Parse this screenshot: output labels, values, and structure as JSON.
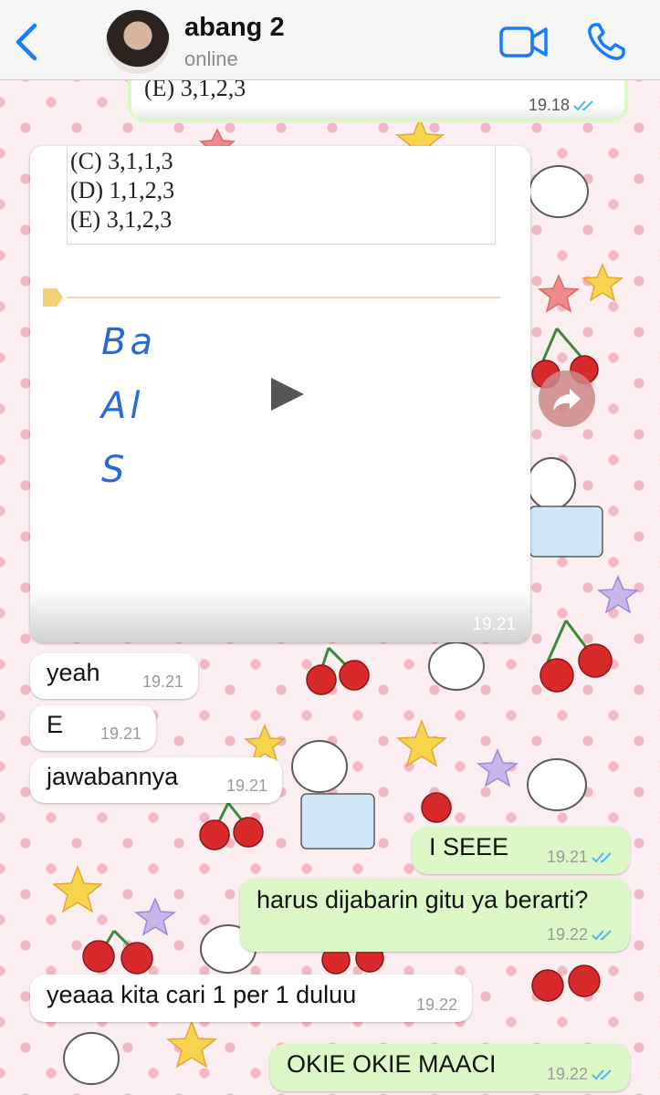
{
  "header": {
    "contact_name": "abang 2",
    "status": "online"
  },
  "top_media": {
    "option_text": "(E)  3,1,2,3",
    "time": "19.18"
  },
  "video_message": {
    "options": [
      "(C)  3,1,1,3",
      "(D)  1,1,2,3",
      "(E)  3,1,2,3"
    ],
    "handwriting": [
      "Ba",
      "Al",
      "S"
    ],
    "time": "19.21"
  },
  "messages": [
    {
      "id": "yeah",
      "direction": "in",
      "text": "yeah",
      "time": "19.21"
    },
    {
      "id": "e",
      "direction": "in",
      "text": "E",
      "time": "19.21"
    },
    {
      "id": "jawabannya",
      "direction": "in",
      "text": "jawabannya",
      "time": "19.21"
    },
    {
      "id": "iseee",
      "direction": "out",
      "text": "I SEEE",
      "time": "19.21"
    },
    {
      "id": "harus",
      "direction": "out",
      "text": "harus dijabarin gitu ya berarti?",
      "time": "19.22"
    },
    {
      "id": "yeaaa",
      "direction": "in",
      "text": "yeaaa kita cari 1 per 1 duluu",
      "time": "19.22"
    },
    {
      "id": "okie",
      "direction": "out",
      "text": "OKIE OKIE MAACI",
      "time": "19.22"
    }
  ],
  "colors": {
    "accent": "#147efb",
    "incoming_bubble": "#ffffff",
    "outgoing_bubble": "#dcf8c6",
    "read_ticks": "#4fb6ec",
    "wallpaper_dots": "#f2b6c3"
  }
}
